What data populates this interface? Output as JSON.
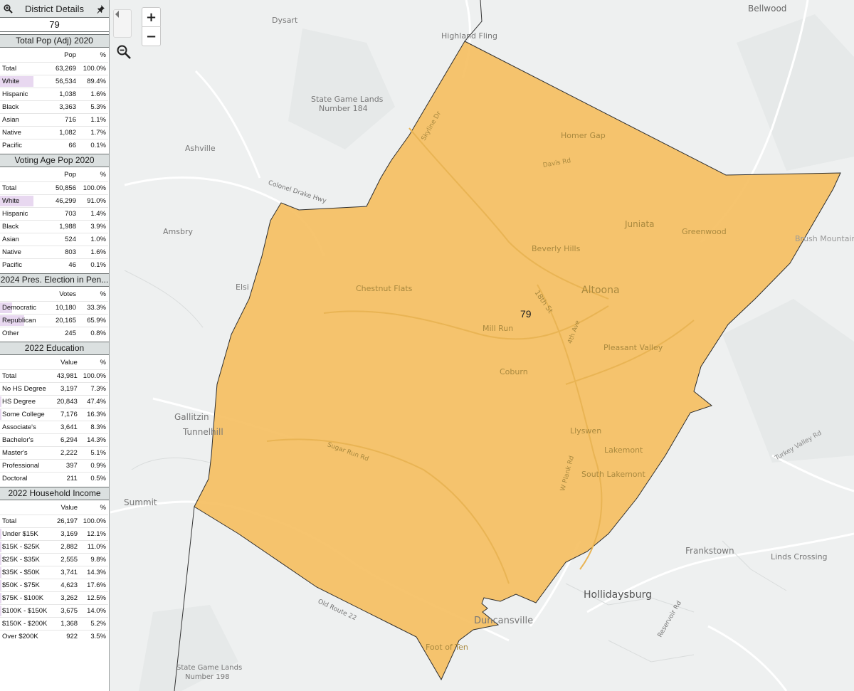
{
  "panel": {
    "title": "District Details",
    "district_number": "79"
  },
  "sections": [
    {
      "title": "Total Pop (Adj) 2020",
      "col_label": "Pop",
      "pct_label": "%",
      "rows": [
        {
          "label": "Total",
          "value": "63,269",
          "pct": "100.0%"
        },
        {
          "label": "White",
          "value": "56,534",
          "pct": "89.4%",
          "bar": 0.9
        },
        {
          "label": "Hispanic",
          "value": "1,038",
          "pct": "1.6%"
        },
        {
          "label": "Black",
          "value": "3,363",
          "pct": "5.3%"
        },
        {
          "label": "Asian",
          "value": "716",
          "pct": "1.1%"
        },
        {
          "label": "Native",
          "value": "1,082",
          "pct": "1.7%"
        },
        {
          "label": "Pacific",
          "value": "66",
          "pct": "0.1%"
        }
      ]
    },
    {
      "title": "Voting Age Pop 2020",
      "col_label": "Pop",
      "pct_label": "%",
      "rows": [
        {
          "label": "Total",
          "value": "50,856",
          "pct": "100.0%"
        },
        {
          "label": "White",
          "value": "46,299",
          "pct": "91.0%",
          "bar": 0.91
        },
        {
          "label": "Hispanic",
          "value": "703",
          "pct": "1.4%"
        },
        {
          "label": "Black",
          "value": "1,988",
          "pct": "3.9%"
        },
        {
          "label": "Asian",
          "value": "524",
          "pct": "1.0%"
        },
        {
          "label": "Native",
          "value": "803",
          "pct": "1.6%"
        },
        {
          "label": "Pacific",
          "value": "46",
          "pct": "0.1%"
        }
      ]
    },
    {
      "title": "2024 Pres. Election in Pen...",
      "col_label": "Votes",
      "pct_label": "%",
      "rows": [
        {
          "label": "Democratic",
          "value": "10,180",
          "pct": "33.3%",
          "bar": 0.333
        },
        {
          "label": "Republican",
          "value": "20,165",
          "pct": "65.9%",
          "bar": 0.659
        },
        {
          "label": "Other",
          "value": "245",
          "pct": "0.8%"
        }
      ]
    },
    {
      "title": "2022 Education",
      "col_label": "Value",
      "pct_label": "%",
      "rows": [
        {
          "label": "Total",
          "value": "43,981",
          "pct": "100.0%"
        },
        {
          "label": "No HS Degree",
          "value": "3,197",
          "pct": "7.3%"
        },
        {
          "label": "HS Degree",
          "value": "20,843",
          "pct": "47.4%",
          "bar": 0.04
        },
        {
          "label": "Some College",
          "value": "7,176",
          "pct": "16.3%",
          "bar": 0.04
        },
        {
          "label": "Associate's",
          "value": "3,641",
          "pct": "8.3%"
        },
        {
          "label": "Bachelor's",
          "value": "6,294",
          "pct": "14.3%"
        },
        {
          "label": "Master's",
          "value": "2,222",
          "pct": "5.1%"
        },
        {
          "label": "Professional",
          "value": "397",
          "pct": "0.9%"
        },
        {
          "label": "Doctoral",
          "value": "211",
          "pct": "0.5%"
        }
      ]
    },
    {
      "title": "2022 Household Income",
      "col_label": "Value",
      "pct_label": "%",
      "rows": [
        {
          "label": "Total",
          "value": "26,197",
          "pct": "100.0%"
        },
        {
          "label": "Under $15K",
          "value": "3,169",
          "pct": "12.1%",
          "bar": 0.04
        },
        {
          "label": "$15K - $25K",
          "value": "2,882",
          "pct": "11.0%",
          "bar": 0.04
        },
        {
          "label": "$25K - $35K",
          "value": "2,555",
          "pct": "9.8%",
          "bar": 0.04
        },
        {
          "label": "$35K - $50K",
          "value": "3,741",
          "pct": "14.3%",
          "bar": 0.04
        },
        {
          "label": "$50K - $75K",
          "value": "4,623",
          "pct": "17.6%",
          "bar": 0.04
        },
        {
          "label": "$75K - $100K",
          "value": "3,262",
          "pct": "12.5%",
          "bar": 0.04
        },
        {
          "label": "$100K - $150K",
          "value": "3,675",
          "pct": "14.0%",
          "bar": 0.04
        },
        {
          "label": "$150K - $200K",
          "value": "1,368",
          "pct": "5.2%"
        },
        {
          "label": "Over $200K",
          "value": "922",
          "pct": "3.5%"
        }
      ]
    }
  ],
  "map": {
    "district_label": "79",
    "district_fill": "#f5be5e",
    "place_labels": [
      "Bellwood",
      "Dysart",
      "Highland Fling",
      "State Game Lands",
      "Number 184",
      "Homer Gap",
      "Davis Rd",
      "Skyline Dr",
      "Ashville",
      "Colonel Drake Hwy",
      "Juniata",
      "Greenwood",
      "Brush Mountain",
      "Amsbry",
      "Beverly Hills",
      "Chestnut Flats",
      "Elsi",
      "18th St",
      "Altoona",
      "Mill Run",
      "4th Ave",
      "Pleasant Valley",
      "Coburn",
      "Gallitzin",
      "Tunnelhill",
      "Sugar Run Rd",
      "Llyswen",
      "Lakemont",
      "Turkey Valley Rd",
      "South Lakemont",
      "Summit",
      "W Plank Rd",
      "Frankstown",
      "Linds Crossing",
      "Hollidaysburg",
      "Old Route 22",
      "Duncansville",
      "Reservoir Rd",
      "Foot of Ten",
      "State Game Lands",
      "Number 198"
    ],
    "controls": {
      "zoom_in": "+",
      "zoom_out": "−"
    }
  }
}
